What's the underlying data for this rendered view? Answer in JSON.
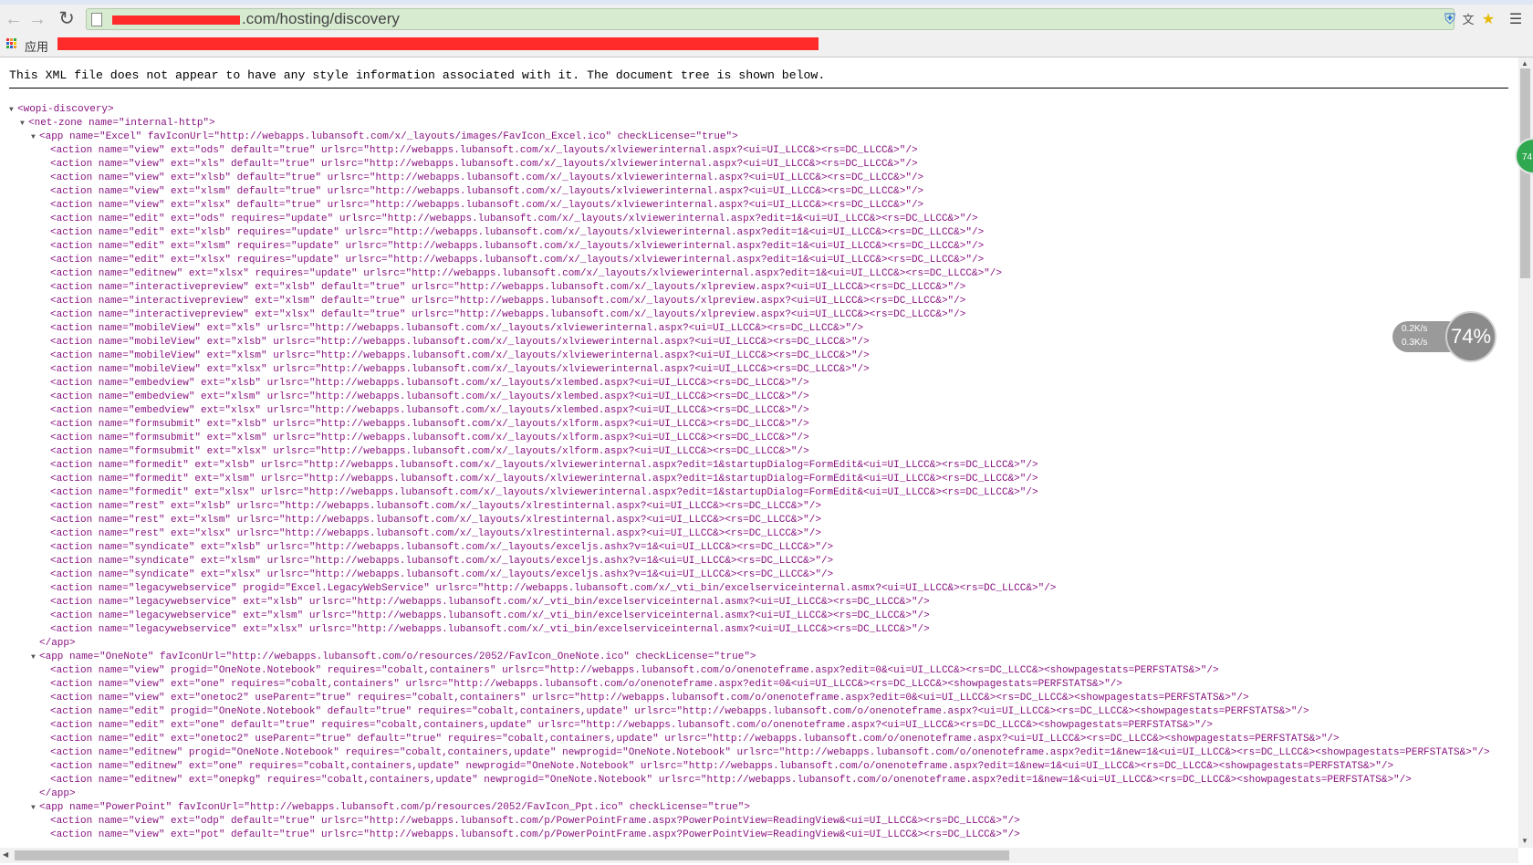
{
  "browser": {
    "url_visible": ".com/hosting/discovery",
    "bookmarks_apps_label": "应用",
    "zoom_badge": "74"
  },
  "speed_widget": {
    "up": "0.2K/s",
    "down": "0.3K/s",
    "percent": "74%"
  },
  "notice": "This XML file does not appear to have any style information associated with it. The document tree is shown below.",
  "xml_lines": [
    {
      "d": 0,
      "t": "▼",
      "x": "<wopi-discovery>"
    },
    {
      "d": 1,
      "t": "▼",
      "x": "<net-zone name=\"internal-http\">"
    },
    {
      "d": 2,
      "t": "▼",
      "x": "<app name=\"Excel\" favIconUrl=\"http://webapps.lubansoft.com/x/_layouts/images/FavIcon_Excel.ico\" checkLicense=\"true\">"
    },
    {
      "d": 3,
      "t": "",
      "x": "<action name=\"view\" ext=\"ods\" default=\"true\" urlsrc=\"http://webapps.lubansoft.com/x/_layouts/xlviewerinternal.aspx?<ui=UI_LLCC&><rs=DC_LLCC&>\"/>"
    },
    {
      "d": 3,
      "t": "",
      "x": "<action name=\"view\" ext=\"xls\" default=\"true\" urlsrc=\"http://webapps.lubansoft.com/x/_layouts/xlviewerinternal.aspx?<ui=UI_LLCC&><rs=DC_LLCC&>\"/>"
    },
    {
      "d": 3,
      "t": "",
      "x": "<action name=\"view\" ext=\"xlsb\" default=\"true\" urlsrc=\"http://webapps.lubansoft.com/x/_layouts/xlviewerinternal.aspx?<ui=UI_LLCC&><rs=DC_LLCC&>\"/>"
    },
    {
      "d": 3,
      "t": "",
      "x": "<action name=\"view\" ext=\"xlsm\" default=\"true\" urlsrc=\"http://webapps.lubansoft.com/x/_layouts/xlviewerinternal.aspx?<ui=UI_LLCC&><rs=DC_LLCC&>\"/>"
    },
    {
      "d": 3,
      "t": "",
      "x": "<action name=\"view\" ext=\"xlsx\" default=\"true\" urlsrc=\"http://webapps.lubansoft.com/x/_layouts/xlviewerinternal.aspx?<ui=UI_LLCC&><rs=DC_LLCC&>\"/>"
    },
    {
      "d": 3,
      "t": "",
      "x": "<action name=\"edit\" ext=\"ods\" requires=\"update\" urlsrc=\"http://webapps.lubansoft.com/x/_layouts/xlviewerinternal.aspx?edit=1&<ui=UI_LLCC&><rs=DC_LLCC&>\"/>"
    },
    {
      "d": 3,
      "t": "",
      "x": "<action name=\"edit\" ext=\"xlsb\" requires=\"update\" urlsrc=\"http://webapps.lubansoft.com/x/_layouts/xlviewerinternal.aspx?edit=1&<ui=UI_LLCC&><rs=DC_LLCC&>\"/>"
    },
    {
      "d": 3,
      "t": "",
      "x": "<action name=\"edit\" ext=\"xlsm\" requires=\"update\" urlsrc=\"http://webapps.lubansoft.com/x/_layouts/xlviewerinternal.aspx?edit=1&<ui=UI_LLCC&><rs=DC_LLCC&>\"/>"
    },
    {
      "d": 3,
      "t": "",
      "x": "<action name=\"edit\" ext=\"xlsx\" requires=\"update\" urlsrc=\"http://webapps.lubansoft.com/x/_layouts/xlviewerinternal.aspx?edit=1&<ui=UI_LLCC&><rs=DC_LLCC&>\"/>"
    },
    {
      "d": 3,
      "t": "",
      "x": "<action name=\"editnew\" ext=\"xlsx\" requires=\"update\" urlsrc=\"http://webapps.lubansoft.com/x/_layouts/xlviewerinternal.aspx?edit=1&<ui=UI_LLCC&><rs=DC_LLCC&>\"/>"
    },
    {
      "d": 3,
      "t": "",
      "x": "<action name=\"interactivepreview\" ext=\"xlsb\" default=\"true\" urlsrc=\"http://webapps.lubansoft.com/x/_layouts/xlpreview.aspx?<ui=UI_LLCC&><rs=DC_LLCC&>\"/>"
    },
    {
      "d": 3,
      "t": "",
      "x": "<action name=\"interactivepreview\" ext=\"xlsm\" default=\"true\" urlsrc=\"http://webapps.lubansoft.com/x/_layouts/xlpreview.aspx?<ui=UI_LLCC&><rs=DC_LLCC&>\"/>"
    },
    {
      "d": 3,
      "t": "",
      "x": "<action name=\"interactivepreview\" ext=\"xlsx\" default=\"true\" urlsrc=\"http://webapps.lubansoft.com/x/_layouts/xlpreview.aspx?<ui=UI_LLCC&><rs=DC_LLCC&>\"/>"
    },
    {
      "d": 3,
      "t": "",
      "x": "<action name=\"mobileView\" ext=\"xls\" urlsrc=\"http://webapps.lubansoft.com/x/_layouts/xlviewerinternal.aspx?<ui=UI_LLCC&><rs=DC_LLCC&>\"/>"
    },
    {
      "d": 3,
      "t": "",
      "x": "<action name=\"mobileView\" ext=\"xlsb\" urlsrc=\"http://webapps.lubansoft.com/x/_layouts/xlviewerinternal.aspx?<ui=UI_LLCC&><rs=DC_LLCC&>\"/>"
    },
    {
      "d": 3,
      "t": "",
      "x": "<action name=\"mobileView\" ext=\"xlsm\" urlsrc=\"http://webapps.lubansoft.com/x/_layouts/xlviewerinternal.aspx?<ui=UI_LLCC&><rs=DC_LLCC&>\"/>"
    },
    {
      "d": 3,
      "t": "",
      "x": "<action name=\"mobileView\" ext=\"xlsx\" urlsrc=\"http://webapps.lubansoft.com/x/_layouts/xlviewerinternal.aspx?<ui=UI_LLCC&><rs=DC_LLCC&>\"/>"
    },
    {
      "d": 3,
      "t": "",
      "x": "<action name=\"embedview\" ext=\"xlsb\" urlsrc=\"http://webapps.lubansoft.com/x/_layouts/xlembed.aspx?<ui=UI_LLCC&><rs=DC_LLCC&>\"/>"
    },
    {
      "d": 3,
      "t": "",
      "x": "<action name=\"embedview\" ext=\"xlsm\" urlsrc=\"http://webapps.lubansoft.com/x/_layouts/xlembed.aspx?<ui=UI_LLCC&><rs=DC_LLCC&>\"/>"
    },
    {
      "d": 3,
      "t": "",
      "x": "<action name=\"embedview\" ext=\"xlsx\" urlsrc=\"http://webapps.lubansoft.com/x/_layouts/xlembed.aspx?<ui=UI_LLCC&><rs=DC_LLCC&>\"/>"
    },
    {
      "d": 3,
      "t": "",
      "x": "<action name=\"formsubmit\" ext=\"xlsb\" urlsrc=\"http://webapps.lubansoft.com/x/_layouts/xlform.aspx?<ui=UI_LLCC&><rs=DC_LLCC&>\"/>"
    },
    {
      "d": 3,
      "t": "",
      "x": "<action name=\"formsubmit\" ext=\"xlsm\" urlsrc=\"http://webapps.lubansoft.com/x/_layouts/xlform.aspx?<ui=UI_LLCC&><rs=DC_LLCC&>\"/>"
    },
    {
      "d": 3,
      "t": "",
      "x": "<action name=\"formsubmit\" ext=\"xlsx\" urlsrc=\"http://webapps.lubansoft.com/x/_layouts/xlform.aspx?<ui=UI_LLCC&><rs=DC_LLCC&>\"/>"
    },
    {
      "d": 3,
      "t": "",
      "x": "<action name=\"formedit\" ext=\"xlsb\" urlsrc=\"http://webapps.lubansoft.com/x/_layouts/xlviewerinternal.aspx?edit=1&startupDialog=FormEdit&<ui=UI_LLCC&><rs=DC_LLCC&>\"/>"
    },
    {
      "d": 3,
      "t": "",
      "x": "<action name=\"formedit\" ext=\"xlsm\" urlsrc=\"http://webapps.lubansoft.com/x/_layouts/xlviewerinternal.aspx?edit=1&startupDialog=FormEdit&<ui=UI_LLCC&><rs=DC_LLCC&>\"/>"
    },
    {
      "d": 3,
      "t": "",
      "x": "<action name=\"formedit\" ext=\"xlsx\" urlsrc=\"http://webapps.lubansoft.com/x/_layouts/xlviewerinternal.aspx?edit=1&startupDialog=FormEdit&<ui=UI_LLCC&><rs=DC_LLCC&>\"/>"
    },
    {
      "d": 3,
      "t": "",
      "x": "<action name=\"rest\" ext=\"xlsb\" urlsrc=\"http://webapps.lubansoft.com/x/_layouts/xlrestinternal.aspx?<ui=UI_LLCC&><rs=DC_LLCC&>\"/>"
    },
    {
      "d": 3,
      "t": "",
      "x": "<action name=\"rest\" ext=\"xlsm\" urlsrc=\"http://webapps.lubansoft.com/x/_layouts/xlrestinternal.aspx?<ui=UI_LLCC&><rs=DC_LLCC&>\"/>"
    },
    {
      "d": 3,
      "t": "",
      "x": "<action name=\"rest\" ext=\"xlsx\" urlsrc=\"http://webapps.lubansoft.com/x/_layouts/xlrestinternal.aspx?<ui=UI_LLCC&><rs=DC_LLCC&>\"/>"
    },
    {
      "d": 3,
      "t": "",
      "x": "<action name=\"syndicate\" ext=\"xlsb\" urlsrc=\"http://webapps.lubansoft.com/x/_layouts/exceljs.ashx?v=1&<ui=UI_LLCC&><rs=DC_LLCC&>\"/>"
    },
    {
      "d": 3,
      "t": "",
      "x": "<action name=\"syndicate\" ext=\"xlsm\" urlsrc=\"http://webapps.lubansoft.com/x/_layouts/exceljs.ashx?v=1&<ui=UI_LLCC&><rs=DC_LLCC&>\"/>"
    },
    {
      "d": 3,
      "t": "",
      "x": "<action name=\"syndicate\" ext=\"xlsx\" urlsrc=\"http://webapps.lubansoft.com/x/_layouts/exceljs.ashx?v=1&<ui=UI_LLCC&><rs=DC_LLCC&>\"/>"
    },
    {
      "d": 3,
      "t": "",
      "x": "<action name=\"legacywebservice\" progid=\"Excel.LegacyWebService\" urlsrc=\"http://webapps.lubansoft.com/x/_vti_bin/excelserviceinternal.asmx?<ui=UI_LLCC&><rs=DC_LLCC&>\"/>"
    },
    {
      "d": 3,
      "t": "",
      "x": "<action name=\"legacywebservice\" ext=\"xlsb\" urlsrc=\"http://webapps.lubansoft.com/x/_vti_bin/excelserviceinternal.asmx?<ui=UI_LLCC&><rs=DC_LLCC&>\"/>"
    },
    {
      "d": 3,
      "t": "",
      "x": "<action name=\"legacywebservice\" ext=\"xlsm\" urlsrc=\"http://webapps.lubansoft.com/x/_vti_bin/excelserviceinternal.asmx?<ui=UI_LLCC&><rs=DC_LLCC&>\"/>"
    },
    {
      "d": 3,
      "t": "",
      "x": "<action name=\"legacywebservice\" ext=\"xlsx\" urlsrc=\"http://webapps.lubansoft.com/x/_vti_bin/excelserviceinternal.asmx?<ui=UI_LLCC&><rs=DC_LLCC&>\"/>"
    },
    {
      "d": 2,
      "t": "",
      "x": "</app>"
    },
    {
      "d": 2,
      "t": "▼",
      "x": "<app name=\"OneNote\" favIconUrl=\"http://webapps.lubansoft.com/o/resources/2052/FavIcon_OneNote.ico\" checkLicense=\"true\">"
    },
    {
      "d": 3,
      "t": "",
      "x": "<action name=\"view\" progid=\"OneNote.Notebook\" requires=\"cobalt,containers\" urlsrc=\"http://webapps.lubansoft.com/o/onenoteframe.aspx?edit=0&<ui=UI_LLCC&><rs=DC_LLCC&><showpagestats=PERFSTATS&>\"/>"
    },
    {
      "d": 3,
      "t": "",
      "x": "<action name=\"view\" ext=\"one\" requires=\"cobalt,containers\" urlsrc=\"http://webapps.lubansoft.com/o/onenoteframe.aspx?edit=0&<ui=UI_LLCC&><rs=DC_LLCC&><showpagestats=PERFSTATS&>\"/>"
    },
    {
      "d": 3,
      "t": "",
      "x": "<action name=\"view\" ext=\"onetoc2\" useParent=\"true\" requires=\"cobalt,containers\" urlsrc=\"http://webapps.lubansoft.com/o/onenoteframe.aspx?edit=0&<ui=UI_LLCC&><rs=DC_LLCC&><showpagestats=PERFSTATS&>\"/>"
    },
    {
      "d": 3,
      "t": "",
      "x": "<action name=\"edit\" progid=\"OneNote.Notebook\" default=\"true\" requires=\"cobalt,containers,update\" urlsrc=\"http://webapps.lubansoft.com/o/onenoteframe.aspx?<ui=UI_LLCC&><rs=DC_LLCC&><showpagestats=PERFSTATS&>\"/>"
    },
    {
      "d": 3,
      "t": "",
      "x": "<action name=\"edit\" ext=\"one\" default=\"true\" requires=\"cobalt,containers,update\" urlsrc=\"http://webapps.lubansoft.com/o/onenoteframe.aspx?<ui=UI_LLCC&><rs=DC_LLCC&><showpagestats=PERFSTATS&>\"/>"
    },
    {
      "d": 3,
      "t": "",
      "x": "<action name=\"edit\" ext=\"onetoc2\" useParent=\"true\" default=\"true\" requires=\"cobalt,containers,update\" urlsrc=\"http://webapps.lubansoft.com/o/onenoteframe.aspx?<ui=UI_LLCC&><rs=DC_LLCC&><showpagestats=PERFSTATS&>\"/>"
    },
    {
      "d": 3,
      "t": "",
      "x": "<action name=\"editnew\" progid=\"OneNote.Notebook\" requires=\"cobalt,containers,update\" newprogid=\"OneNote.Notebook\" urlsrc=\"http://webapps.lubansoft.com/o/onenoteframe.aspx?edit=1&new=1&<ui=UI_LLCC&><rs=DC_LLCC&><showpagestats=PERFSTATS&>\"/>"
    },
    {
      "d": 3,
      "t": "",
      "x": "<action name=\"editnew\" ext=\"one\" requires=\"cobalt,containers,update\" newprogid=\"OneNote.Notebook\" urlsrc=\"http://webapps.lubansoft.com/o/onenoteframe.aspx?edit=1&new=1&<ui=UI_LLCC&><rs=DC_LLCC&><showpagestats=PERFSTATS&>\"/>"
    },
    {
      "d": 3,
      "t": "",
      "x": "<action name=\"editnew\" ext=\"onepkg\" requires=\"cobalt,containers,update\" newprogid=\"OneNote.Notebook\" urlsrc=\"http://webapps.lubansoft.com/o/onenoteframe.aspx?edit=1&new=1&<ui=UI_LLCC&><rs=DC_LLCC&><showpagestats=PERFSTATS&>\"/>"
    },
    {
      "d": 2,
      "t": "",
      "x": "</app>"
    },
    {
      "d": 2,
      "t": "▼",
      "x": "<app name=\"PowerPoint\" favIconUrl=\"http://webapps.lubansoft.com/p/resources/2052/FavIcon_Ppt.ico\" checkLicense=\"true\">"
    },
    {
      "d": 3,
      "t": "",
      "x": "<action name=\"view\" ext=\"odp\" default=\"true\" urlsrc=\"http://webapps.lubansoft.com/p/PowerPointFrame.aspx?PowerPointView=ReadingView&<ui=UI_LLCC&><rs=DC_LLCC&>\"/>"
    },
    {
      "d": 3,
      "t": "",
      "x": "<action name=\"view\" ext=\"pot\" default=\"true\" urlsrc=\"http://webapps.lubansoft.com/p/PowerPointFrame.aspx?PowerPointView=ReadingView&<ui=UI_LLCC&><rs=DC_LLCC&>\"/>"
    }
  ]
}
